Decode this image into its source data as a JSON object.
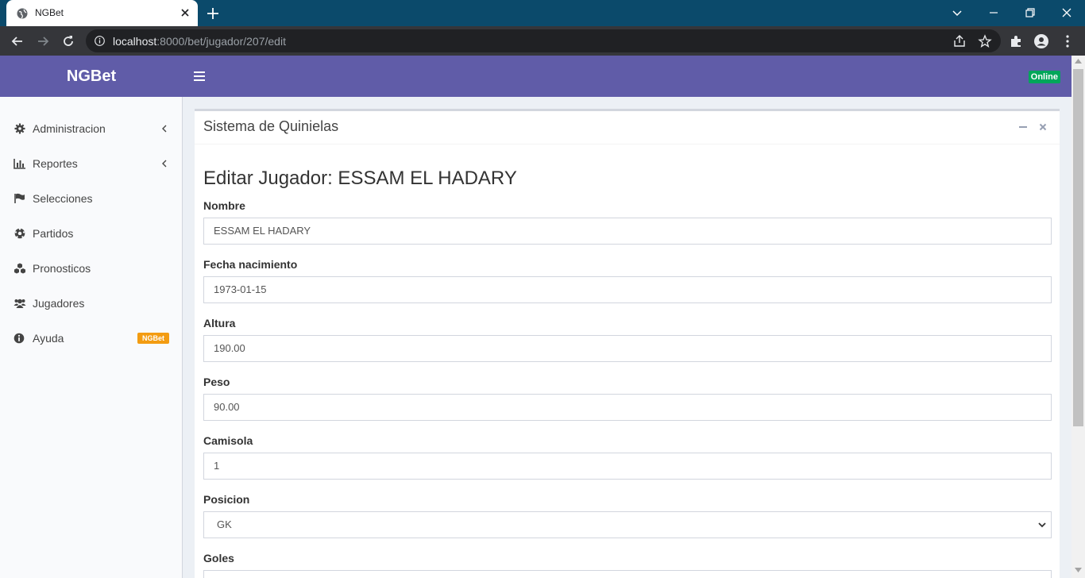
{
  "browser": {
    "tab_title": "NGBet",
    "url_host": "localhost",
    "url_path": ":8000/bet/jugador/207/edit"
  },
  "navbar": {
    "logo": "NGBet",
    "status": "Online"
  },
  "sidebar": {
    "items": [
      {
        "label": "Administracion",
        "icon": "gear-icon"
      },
      {
        "label": "Reportes",
        "icon": "bar-chart-icon"
      },
      {
        "label": "Selecciones",
        "icon": "flag-icon"
      },
      {
        "label": "Partidos",
        "icon": "soccer-ball-icon"
      },
      {
        "label": "Pronosticos",
        "icon": "cubes-icon"
      },
      {
        "label": "Jugadores",
        "icon": "users-icon"
      },
      {
        "label": "Ayuda",
        "icon": "info-icon",
        "badge": "NGBet"
      }
    ]
  },
  "box": {
    "title": "Sistema de Quinielas"
  },
  "form": {
    "heading": "Editar Jugador: ESSAM EL HADARY",
    "fields": [
      {
        "label": "Nombre",
        "value": "ESSAM EL HADARY"
      },
      {
        "label": "Fecha nacimiento",
        "value": "1973-01-15"
      },
      {
        "label": "Altura",
        "value": "190.00"
      },
      {
        "label": "Peso",
        "value": "90.00"
      },
      {
        "label": "Camisola",
        "value": "1"
      },
      {
        "label": "Posicion",
        "value": "GK"
      },
      {
        "label": "Goles",
        "value": ""
      }
    ]
  },
  "colors": {
    "navbar": "#605ca8",
    "browser_frame": "#0b4a6b",
    "online_badge": "#00a65a",
    "help_badge": "#f39c12"
  }
}
